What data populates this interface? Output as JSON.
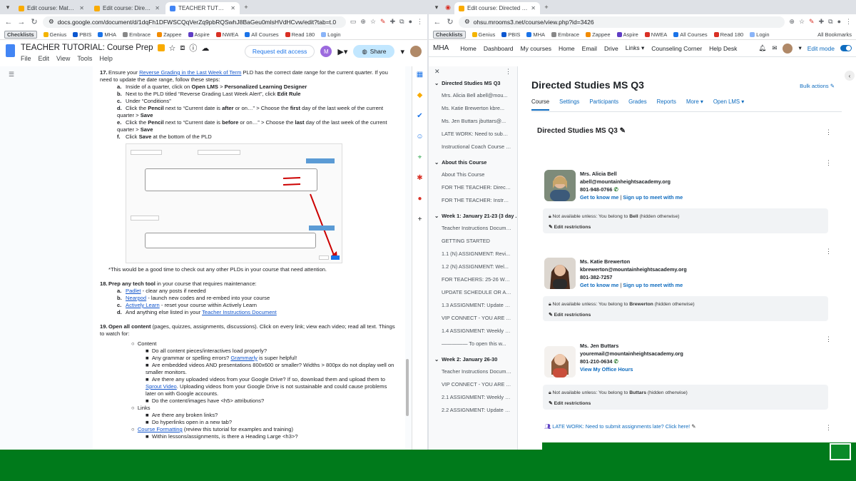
{
  "left": {
    "tabs": [
      {
        "title": "Edit course: Math Essential Ele",
        "color": "#f9ab00"
      },
      {
        "title": "Edit course: Directed Studies M",
        "color": "#f9ab00"
      },
      {
        "title": "TEACHER TUTORIAL: Course P",
        "color": "#4285f4",
        "active": true
      }
    ],
    "url": "docs.google.com/document/d/1dqFh1DFWSCQqVerZq9pbRQSwhJ8BaGeu0mlsHVdHCvw/edit?tab=t.0",
    "bookmarks": [
      "Checklists",
      "Genius",
      "PBIS",
      "MHA",
      "Embrace",
      "Zappee",
      "Aspire",
      "NWEA",
      "All Courses",
      "Read 180",
      "Login"
    ],
    "all_bookmarks": "All Bookmarks",
    "doc_title": "TEACHER TUTORIAL: Course Prep",
    "menus": [
      "File",
      "Edit",
      "View",
      "Tools",
      "Help"
    ],
    "request_edit": "Request edit access",
    "avatar_letter": "M",
    "share": "Share",
    "content": {
      "i17": {
        "num": "17.",
        "pre": "Ensure your ",
        "link": "Reverse Grading in the Last Week of Term",
        "post": " PLD has the correct date range for the current quarter. If you need to update the date range, follow these steps:"
      },
      "i17a": {
        "l": "a.",
        "pre": "Inside of a quarter, click on ",
        "b1": "Open LMS",
        "mid": " > ",
        "b2": "Personalized Learning Designer"
      },
      "i17b": {
        "l": "b.",
        "pre": "Next to the PLD titled “Reverse Grading Last Week Alert”, click ",
        "b": "Edit Rule"
      },
      "i17c": {
        "l": "c.",
        "text": "Under “Conditions”"
      },
      "i17d": {
        "l": "d.",
        "pre": "Click the ",
        "b1": "Pencil",
        "mid": " next to “Current date is ",
        "b2": "after",
        "mid2": " or on…” > Choose the ",
        "b3": "first",
        "post": " day of the last week of the current quarter > ",
        "b4": "Save"
      },
      "i17e": {
        "l": "e.",
        "pre": "Click the ",
        "b1": "Pencil",
        "mid": " next to “Current date is ",
        "b2": "before",
        "mid2": " or on…” > Choose the ",
        "b3": "last",
        "post": " day of the last week of the current quarter > ",
        "b4": "Save"
      },
      "i17f": {
        "l": "f.",
        "pre": "Click ",
        "b": "Save",
        "post": " at the bottom of the PLD"
      },
      "note": "*This would be a good time to check out any other PLDs in your course that need attention.",
      "i18": {
        "num": "18.",
        "b": "Prep any tech tool",
        "post": " in your course that requires maintenance:"
      },
      "i18a": {
        "l": "a.",
        "link": "Padlet",
        "post": " - clear any posts if needed"
      },
      "i18b": {
        "l": "b.",
        "link": "Nearpod",
        "post": " - launch new codes and re-embed into your course"
      },
      "i18c": {
        "l": "c.",
        "link": "Actively Learn",
        "post": " - reset your course within Actively Learn"
      },
      "i18d": {
        "l": "d.",
        "pre": "And anything else listed in your ",
        "link": "Teacher Instructions Document"
      },
      "i19": {
        "num": "19.",
        "b": "Open all content",
        "post": " (pages, quizzes, assignments, discussions). Click on every link; view each video; read all text. Things to watch for:"
      },
      "c_content": "Content",
      "c1": "Do all content pieces/interactives load properly?",
      "c2_pre": "Any grammar or spelling errors? ",
      "c2_link": "Grammarly",
      "c2_post": " is super helpful!",
      "c3": "Are embedded videos AND presentations 800x600 or smaller? Widths > 800px do not display well on smaller monitors.",
      "c4_pre": "Are there any uploaded videos from your Google Drive? If so, download them and upload them to ",
      "c4_link": "Sprout Video",
      "c4_post": ". Uploading videos from your Google Drive is not sustainable and could cause problems later on with Google accounts.",
      "c5": "Do the content/images have <h5> attributions?",
      "c_links": "Links",
      "l1": "Are there any broken links?",
      "l2": "Do hyperlinks open in a new tab?",
      "cf_link": "Course Formatting",
      "cf_post": " (review this tutorial for examples and training)",
      "cf1": "Within lessons/assignments, is there a Heading Large <h3>?"
    }
  },
  "right": {
    "tabs": [
      {
        "title": "Edit course: Directed Studies M",
        "color": "#f9ab00",
        "active": true
      }
    ],
    "url": "ohsu.mrooms3.net/course/view.php?id=3426",
    "bookmarks": [
      "Checklists",
      "Genius",
      "PBIS",
      "MHA",
      "Embrace",
      "Zappee",
      "Aspire",
      "NWEA",
      "All Courses",
      "Read 180",
      "Login"
    ],
    "all_bookmarks": "All Bookmarks",
    "nav": {
      "brand": "MHA",
      "items": [
        "Home",
        "Dashboard",
        "My courses",
        "Home",
        "Email",
        "Drive",
        "Links",
        "Counseling Corner",
        "Help Desk"
      ],
      "edit_mode": "Edit mode"
    },
    "drawer": {
      "sections": [
        {
          "title": "Directed Studies MS Q3",
          "items": [
            "Mrs. Alicia Bell abell@mou...",
            "Ms. Katie Brewerton kbre...",
            "Ms. Jen Buttars jbuttars@...",
            "LATE WORK: Need to submit a...",
            "Instructional Coach Course Re..."
          ]
        },
        {
          "title": "About this Course",
          "items": [
            "About This Course",
            "FOR THE TEACHER: Directed S...",
            "FOR THE TEACHER: Instructio..."
          ]
        },
        {
          "title": "Week 1: January 21-23 (3 day ...",
          "items": [
            "Teacher Instructions Docume...",
            "GETTING STARTED",
            "1.1 (N) ASSIGNMENT: Revi...",
            "1.2 (N) ASSIGNMENT: Wel...",
            "FOR TEACHERS: 25-26 Welco...",
            "UPDATE SCHEDULE OR ASSIG...",
            "1.3 ASSIGNMENT: Update Sch...",
            "VIP CONNECT - YOU ARE A VE...",
            "1.4 ASSIGNMENT: Weekly VIP ...",
            "————— To open this w..."
          ]
        },
        {
          "title": "Week 2: January 26-30",
          "items": [
            "Teacher Instructions Docume...",
            "VIP CONNECT - YOU ARE A VE...",
            "2.1 ASSIGNMENT: Weekly VIP ...",
            "2.2 ASSIGNMENT: Update you..."
          ]
        }
      ]
    },
    "course_title": "Directed Studies MS Q3",
    "bulk_actions": "Bulk actions",
    "secondary_nav": [
      "Course",
      "Settings",
      "Participants",
      "Grades",
      "Reports",
      "More",
      "Open LMS"
    ],
    "section_title": "Directed Studies MS Q3",
    "teachers": [
      {
        "name": "Mrs. Alicia Bell",
        "email": "abell@mountainheightsacademy.org",
        "phone": "801-948-0766",
        "link1": "Get to know me",
        "link2": "Sign up to meet with me",
        "restriction_pre": "Not available unless: You belong to ",
        "group": "Bell",
        "restriction_post": " (hidden otherwise)",
        "edit": "Edit restrictions"
      },
      {
        "name": "Ms. Katie Brewerton",
        "email": "kbrewerton@mountainheightsacademy.org",
        "phone": "801-382-7257",
        "link1": "Get to know me",
        "link2": "Sign up to meet with me",
        "restriction_pre": "Not available unless: You belong to ",
        "group": "Brewerton",
        "restriction_post": " (hidden otherwise)",
        "edit": "Edit restrictions"
      },
      {
        "name": "Ms. Jen Buttars",
        "email": "youremail@mountainheightsacademy.org",
        "phone": "801-210-0634",
        "link1": "View My Office Hours",
        "link2": "",
        "restriction_pre": "Not available unless: You belong to ",
        "group": "Buttars",
        "restriction_post": " (hidden otherwise)",
        "edit": "Edit restrictions"
      }
    ],
    "late_work": "LATE WORK: Need to submit assignments late? Click here!"
  }
}
